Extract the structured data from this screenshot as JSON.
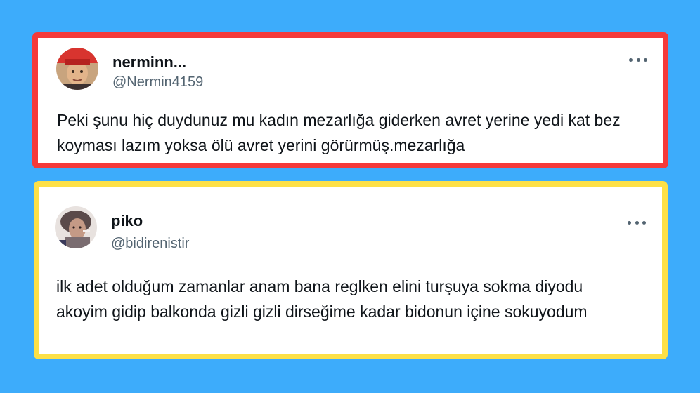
{
  "tweets": [
    {
      "display_name": "nerminn...",
      "handle": "@Nermin4159",
      "text": "Peki şunu hiç duydunuz mu kadın mezarlığa giderken avret yerine yedi kat bez koyması lazım yoksa ölü avret yerini görürmüş.mezarlığa",
      "border_color": "#f43a3a"
    },
    {
      "display_name": "piko",
      "handle": "@bidirenistir",
      "text": "ilk adet olduğum zamanlar anam bana reglken elini turşuya sokma diyodu akoyim gidip balkonda gizli gizli dirseğime kadar bidonun içine sokuyodum",
      "border_color": "#fde047"
    }
  ],
  "icons": {
    "more": "more-options-icon"
  },
  "colors": {
    "background": "#3dacfb",
    "text_primary": "#0f1419",
    "text_secondary": "#536471"
  }
}
